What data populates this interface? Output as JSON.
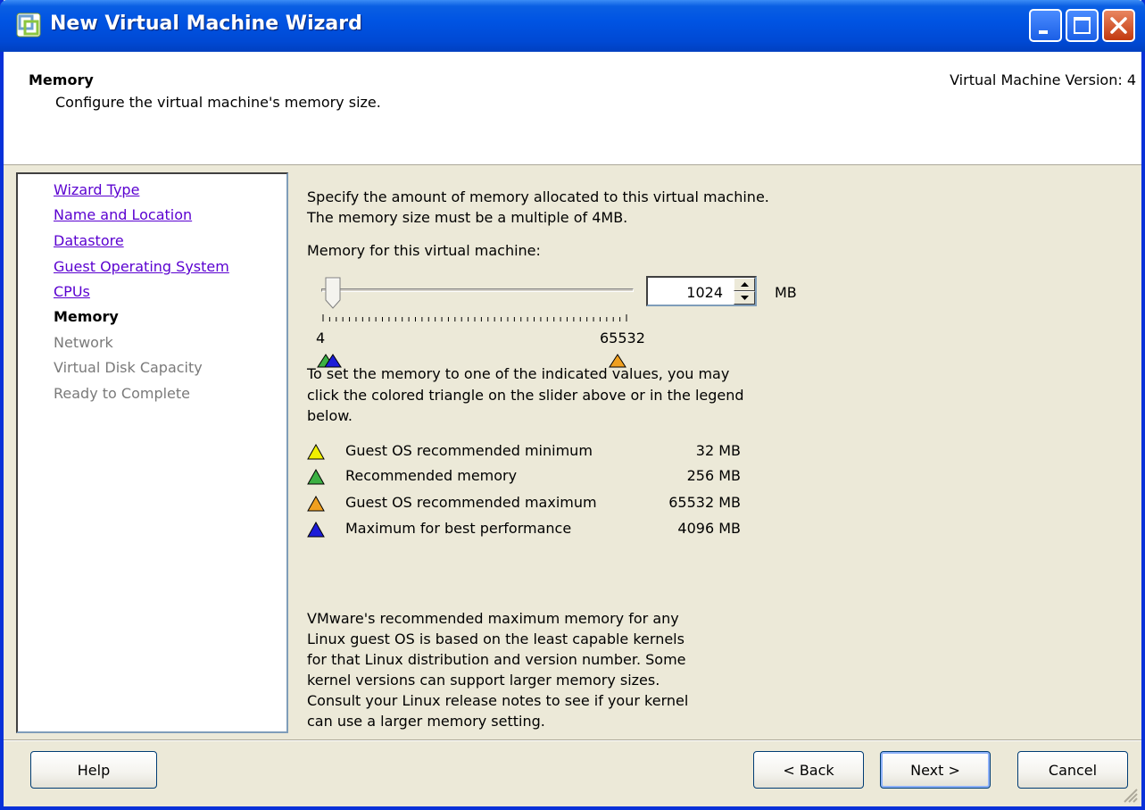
{
  "window": {
    "title": "New Virtual Machine Wizard"
  },
  "header": {
    "title": "Memory",
    "subtitle": "Configure the virtual machine's memory size.",
    "version": "Virtual Machine Version: 4"
  },
  "nav": {
    "items": [
      {
        "label": "Wizard Type",
        "state": "link"
      },
      {
        "label": "Name and Location",
        "state": "link"
      },
      {
        "label": "Datastore",
        "state": "link"
      },
      {
        "label": "Guest Operating System",
        "state": "link"
      },
      {
        "label": "CPUs",
        "state": "link"
      },
      {
        "label": "Memory",
        "state": "current"
      },
      {
        "label": "Network",
        "state": "disabled"
      },
      {
        "label": "Virtual Disk Capacity",
        "state": "disabled"
      },
      {
        "label": "Ready to Complete",
        "state": "disabled"
      }
    ]
  },
  "content": {
    "intro_line1": "Specify the amount of memory allocated to this virtual machine.",
    "intro_line2": "The memory size must be a multiple of 4MB.",
    "memory_label": "Memory for this virtual machine:",
    "slider": {
      "min_label": "4",
      "max_label": "65532",
      "min": 4,
      "max": 65532,
      "value": 1024
    },
    "memory_value": "1024",
    "unit": "MB",
    "hint_line1": "To set the memory to one of the indicated values, you may",
    "hint_line2": "click the colored triangle on the slider above or in the legend",
    "hint_line3": "below.",
    "legend": [
      {
        "label": "Guest OS recommended minimum",
        "value": "32 MB",
        "color": "#f0f000"
      },
      {
        "label": "Recommended memory",
        "value": "256 MB",
        "color": "#3cb043"
      },
      {
        "label": "Guest OS recommended maximum",
        "value": "65532 MB",
        "color": "#f0a020"
      },
      {
        "label": "Maximum for best performance",
        "value": "4096 MB",
        "color": "#1c1cd8"
      }
    ],
    "note_lines": [
      "VMware's recommended maximum memory for any",
      "Linux guest OS is based on the least capable kernels",
      "for that Linux distribution and version number. Some",
      "kernel versions can support larger memory sizes.",
      "Consult your Linux release notes to see if your kernel",
      "can use a larger memory setting."
    ]
  },
  "buttons": {
    "help": "Help",
    "back": "< Back",
    "next": "Next >",
    "cancel": "Cancel"
  },
  "colors": {
    "titlebar": "#0054e3",
    "link": "#5a00d0",
    "disabled": "#7a7a7a",
    "panel": "#ece9d8"
  },
  "icons": [
    "vmware-app-icon",
    "minimize-icon",
    "maximize-icon",
    "close-icon",
    "spin-up-icon",
    "spin-down-icon",
    "resize-grip-icon"
  ]
}
